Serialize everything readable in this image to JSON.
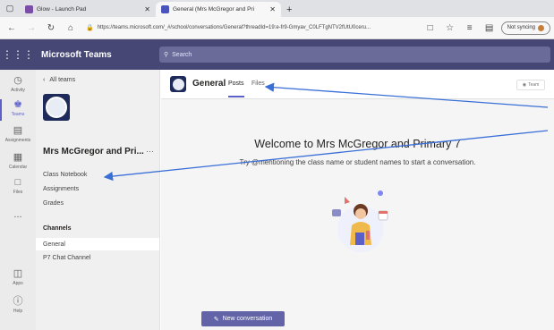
{
  "browser": {
    "tabs": [
      {
        "label": "Glow - Launch Pad",
        "active": false
      },
      {
        "label": "General (Mrs McGregor and Pri",
        "active": true
      }
    ],
    "url": "https://teams.microsoft.com/_#/school/conversations/General?threadId=19:e-fr9-Gmyav_C0LFTgNTV2fUtU0ceru...",
    "sync_label": "Not syncing"
  },
  "teams": {
    "app_title": "Microsoft Teams",
    "search_placeholder": "Search"
  },
  "rail": [
    {
      "label": "Activity",
      "icon": "bell-icon"
    },
    {
      "label": "Teams",
      "icon": "teams-icon",
      "active": true
    },
    {
      "label": "Assignments",
      "icon": "assignments-icon"
    },
    {
      "label": "Calendar",
      "icon": "calendar-icon"
    },
    {
      "label": "Files",
      "icon": "files-icon"
    },
    {
      "label": "...",
      "icon": "more-icon"
    },
    {
      "label": "Apps",
      "icon": "apps-icon"
    },
    {
      "label": "Help",
      "icon": "help-icon"
    }
  ],
  "teampanel": {
    "all_teams": "All teams",
    "team_name": "Mrs McGregor and Pri...",
    "more": "···",
    "links": [
      "Class Notebook",
      "Assignments",
      "Grades"
    ],
    "channels_heading": "Channels",
    "channels": [
      {
        "label": "General",
        "active": true
      },
      {
        "label": "P7 Chat Channel",
        "active": false
      }
    ]
  },
  "channel": {
    "title": "General",
    "tabs": [
      "Posts",
      "Files"
    ],
    "team_button": "Team",
    "welcome_title": "Welcome to Mrs McGregor and Primary 7",
    "welcome_sub": "Try @mentioning the class name or student names to start a conversation.",
    "new_conversation": "New conversation"
  },
  "colors": {
    "teams_header": "#464775",
    "accent": "#5b5fc7",
    "button": "#6264a7",
    "annotation_arrow": "#3a6fd8"
  }
}
